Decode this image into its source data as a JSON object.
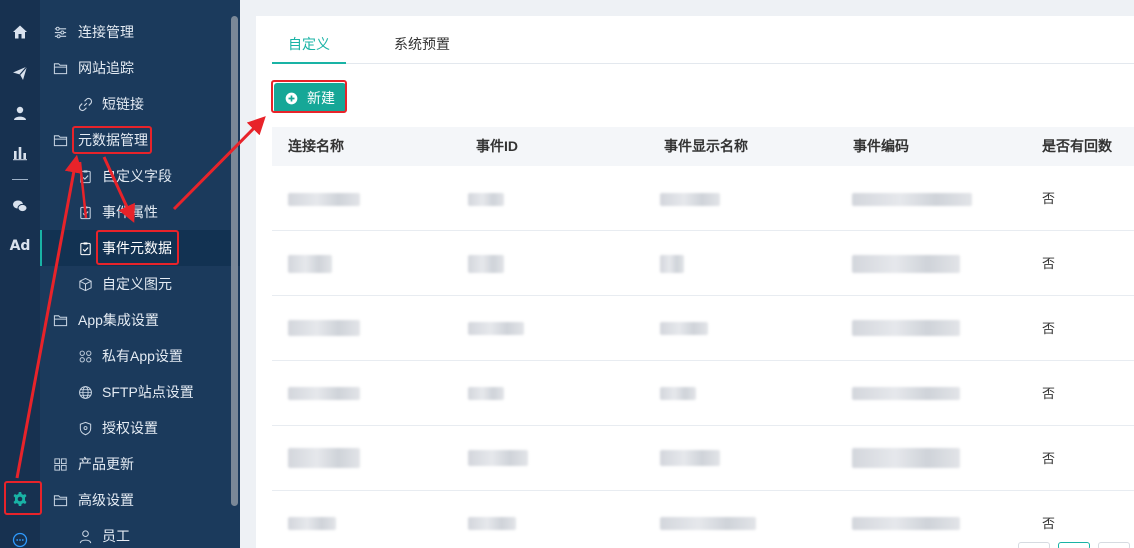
{
  "rail": {
    "icons": [
      "home-icon",
      "send-icon",
      "user-icon",
      "bar-chart-icon",
      "wechat-icon",
      "ad-icon",
      "gear-icon",
      "chat-icon"
    ],
    "ad_text": "Ad"
  },
  "menu": {
    "items": [
      {
        "label": "连接管理",
        "icon": "sliders-icon"
      },
      {
        "label": "网站追踪",
        "icon": "folder-icon"
      },
      {
        "label": "短链接",
        "icon": "link-icon"
      },
      {
        "label": "元数据管理",
        "icon": "folder-icon"
      },
      {
        "label": "自定义字段",
        "icon": "clipboard-icon"
      },
      {
        "label": "事件属性",
        "icon": "clipboard-icon"
      },
      {
        "label": "事件元数据",
        "icon": "clipboard-icon"
      },
      {
        "label": "自定义图元",
        "icon": "cube-icon"
      },
      {
        "label": "App集成设置",
        "icon": "folder-icon"
      },
      {
        "label": "私有App设置",
        "icon": "nodes-icon"
      },
      {
        "label": "SFTP站点设置",
        "icon": "globe-icon"
      },
      {
        "label": "授权设置",
        "icon": "shield-icon"
      },
      {
        "label": "产品更新",
        "icon": "grid-icon"
      },
      {
        "label": "高级设置",
        "icon": "folder-icon"
      },
      {
        "label": "员工",
        "icon": "user-icon"
      }
    ]
  },
  "tabs": [
    {
      "label": "自定义"
    },
    {
      "label": "系统预置"
    }
  ],
  "new_button": {
    "label": "新建",
    "icon": "plus-circle-icon"
  },
  "table": {
    "columns": [
      "连接名称",
      "事件ID",
      "事件显示名称",
      "事件编码",
      "是否有回数"
    ],
    "rows": [
      {
        "returns": "否"
      },
      {
        "returns": "否"
      },
      {
        "returns": "否"
      },
      {
        "returns": "否"
      },
      {
        "returns": "否"
      },
      {
        "returns": "否"
      }
    ]
  },
  "colors": {
    "accent": "#19b3a5",
    "sidebar": "#1b3a5c",
    "rail": "#173150",
    "annotation": "#e8232a"
  }
}
